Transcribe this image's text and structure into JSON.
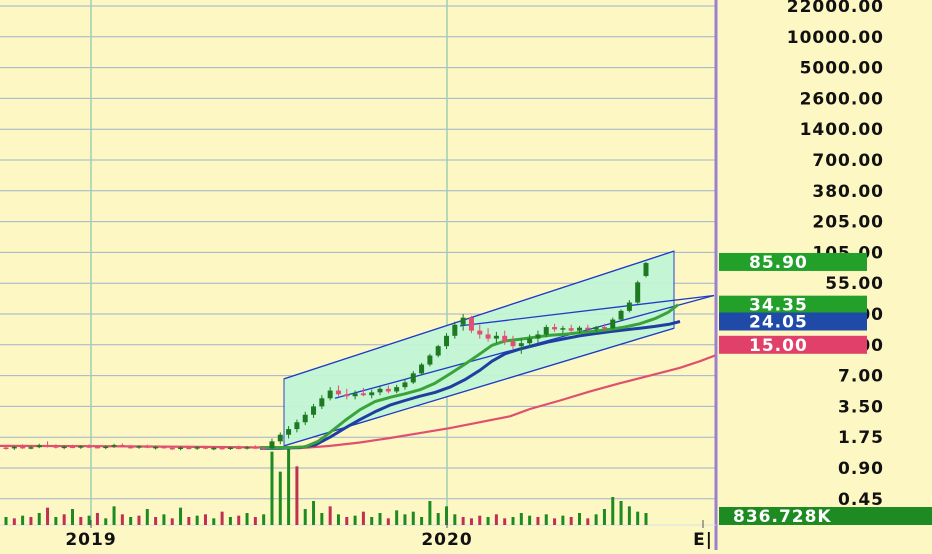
{
  "colors": {
    "background": "#fdf7c3",
    "grid": "#9fb3cc",
    "year_grid": "#9ecfb4",
    "divider": "#9b7fd0",
    "candle_up": "#1e7a22",
    "candle_down": "#e05070",
    "channel_line": "#1f3cc8",
    "channel_fill": "#c2f5d6",
    "ma_green": "#3aa33a",
    "ma_blue": "#1f3fa0",
    "ma_red": "#e0506e",
    "volume_up": "#1e8a22",
    "volume_down": "#c03050"
  },
  "chart_data": {
    "type": "candlestick",
    "scale": "log",
    "y_ticks": [
      "22000.00",
      "10000.00",
      "5000.00",
      "2600.00",
      "1400.00",
      "700.00",
      "380.00",
      "205.00",
      "105.00",
      "55.00",
      "28.00",
      "15.00",
      "7.00",
      "3.50",
      "1.75",
      "0.90",
      "0.45"
    ],
    "x_ticks": [
      "2019",
      "2020",
      "E|"
    ],
    "price_labels": [
      {
        "text": "85.90",
        "color": "#22a02a",
        "value": 85.9
      },
      {
        "text": "34.35",
        "color": "#22a02a",
        "value": 34.35
      },
      {
        "text": "24.05",
        "color": "#1f4aa8",
        "value": 24.05
      },
      {
        "text": "15.00",
        "color": "#e0406a",
        "value": 15.0
      }
    ],
    "volume_label": {
      "text": "836.728K",
      "color": "#1e8a22"
    },
    "ohlc": [
      {
        "o": 1.4,
        "h": 1.48,
        "l": 1.34,
        "c": 1.38
      },
      {
        "o": 1.38,
        "h": 1.45,
        "l": 1.33,
        "c": 1.42
      },
      {
        "o": 1.42,
        "h": 1.5,
        "l": 1.36,
        "c": 1.39
      },
      {
        "o": 1.39,
        "h": 1.46,
        "l": 1.35,
        "c": 1.41
      },
      {
        "o": 1.41,
        "h": 1.52,
        "l": 1.38,
        "c": 1.47
      },
      {
        "o": 1.47,
        "h": 1.6,
        "l": 1.4,
        "c": 1.44
      },
      {
        "o": 1.44,
        "h": 1.5,
        "l": 1.37,
        "c": 1.4
      },
      {
        "o": 1.4,
        "h": 1.46,
        "l": 1.35,
        "c": 1.43
      },
      {
        "o": 1.43,
        "h": 1.49,
        "l": 1.38,
        "c": 1.41
      },
      {
        "o": 1.41,
        "h": 1.47,
        "l": 1.36,
        "c": 1.44
      },
      {
        "o": 1.44,
        "h": 1.5,
        "l": 1.39,
        "c": 1.42
      },
      {
        "o": 1.42,
        "h": 1.47,
        "l": 1.37,
        "c": 1.4
      },
      {
        "o": 1.4,
        "h": 1.46,
        "l": 1.35,
        "c": 1.43
      },
      {
        "o": 1.43,
        "h": 1.52,
        "l": 1.39,
        "c": 1.48
      },
      {
        "o": 1.48,
        "h": 1.53,
        "l": 1.4,
        "c": 1.42
      },
      {
        "o": 1.42,
        "h": 1.48,
        "l": 1.37,
        "c": 1.41
      },
      {
        "o": 1.41,
        "h": 1.47,
        "l": 1.36,
        "c": 1.44
      },
      {
        "o": 1.44,
        "h": 1.49,
        "l": 1.38,
        "c": 1.4
      },
      {
        "o": 1.4,
        "h": 1.45,
        "l": 1.34,
        "c": 1.42
      },
      {
        "o": 1.42,
        "h": 1.46,
        "l": 1.37,
        "c": 1.39
      },
      {
        "o": 1.39,
        "h": 1.44,
        "l": 1.33,
        "c": 1.37
      },
      {
        "o": 1.37,
        "h": 1.43,
        "l": 1.32,
        "c": 1.4
      },
      {
        "o": 1.4,
        "h": 1.45,
        "l": 1.34,
        "c": 1.38
      },
      {
        "o": 1.38,
        "h": 1.44,
        "l": 1.33,
        "c": 1.41
      },
      {
        "o": 1.41,
        "h": 1.45,
        "l": 1.35,
        "c": 1.37
      },
      {
        "o": 1.37,
        "h": 1.42,
        "l": 1.32,
        "c": 1.39
      },
      {
        "o": 1.39,
        "h": 1.44,
        "l": 1.34,
        "c": 1.38
      },
      {
        "o": 1.38,
        "h": 1.43,
        "l": 1.33,
        "c": 1.4
      },
      {
        "o": 1.4,
        "h": 1.46,
        "l": 1.35,
        "c": 1.39
      },
      {
        "o": 1.39,
        "h": 1.45,
        "l": 1.34,
        "c": 1.41
      },
      {
        "o": 1.41,
        "h": 1.47,
        "l": 1.36,
        "c": 1.4
      },
      {
        "o": 1.4,
        "h": 1.45,
        "l": 1.34,
        "c": 1.38
      },
      {
        "o": 1.38,
        "h": 1.7,
        "l": 1.34,
        "c": 1.6
      },
      {
        "o": 1.6,
        "h": 1.95,
        "l": 1.5,
        "c": 1.85
      },
      {
        "o": 1.85,
        "h": 2.25,
        "l": 1.7,
        "c": 2.1
      },
      {
        "o": 2.1,
        "h": 2.6,
        "l": 1.95,
        "c": 2.45
      },
      {
        "o": 2.45,
        "h": 3.1,
        "l": 2.3,
        "c": 2.9
      },
      {
        "o": 2.9,
        "h": 3.7,
        "l": 2.7,
        "c": 3.5
      },
      {
        "o": 3.5,
        "h": 4.5,
        "l": 3.3,
        "c": 4.2
      },
      {
        "o": 4.2,
        "h": 5.4,
        "l": 4.0,
        "c": 5.0
      },
      {
        "o": 5.0,
        "h": 5.6,
        "l": 4.4,
        "c": 4.6
      },
      {
        "o": 4.6,
        "h": 5.2,
        "l": 4.1,
        "c": 4.4
      },
      {
        "o": 4.4,
        "h": 5.0,
        "l": 4.1,
        "c": 4.7
      },
      {
        "o": 4.7,
        "h": 5.3,
        "l": 4.4,
        "c": 4.5
      },
      {
        "o": 4.5,
        "h": 5.1,
        "l": 4.2,
        "c": 4.8
      },
      {
        "o": 4.8,
        "h": 5.5,
        "l": 4.5,
        "c": 5.2
      },
      {
        "o": 5.2,
        "h": 5.6,
        "l": 4.7,
        "c": 4.9
      },
      {
        "o": 4.9,
        "h": 5.7,
        "l": 4.7,
        "c": 5.4
      },
      {
        "o": 5.4,
        "h": 6.4,
        "l": 5.1,
        "c": 6.0
      },
      {
        "o": 6.0,
        "h": 7.8,
        "l": 5.8,
        "c": 7.4
      },
      {
        "o": 7.4,
        "h": 9.6,
        "l": 7.0,
        "c": 9.2
      },
      {
        "o": 9.2,
        "h": 12.0,
        "l": 8.8,
        "c": 11.5
      },
      {
        "o": 11.5,
        "h": 15.0,
        "l": 11.0,
        "c": 14.5
      },
      {
        "o": 14.5,
        "h": 19.0,
        "l": 13.5,
        "c": 18.0
      },
      {
        "o": 18.0,
        "h": 24.0,
        "l": 17.0,
        "c": 22.5
      },
      {
        "o": 22.5,
        "h": 28.0,
        "l": 20.0,
        "c": 26.0
      },
      {
        "o": 26.0,
        "h": 27.0,
        "l": 19.0,
        "c": 20.0
      },
      {
        "o": 20.0,
        "h": 22.5,
        "l": 17.0,
        "c": 18.5
      },
      {
        "o": 18.5,
        "h": 21.0,
        "l": 16.0,
        "c": 17.0
      },
      {
        "o": 17.0,
        "h": 19.5,
        "l": 15.5,
        "c": 18.0
      },
      {
        "o": 18.0,
        "h": 20.0,
        "l": 15.0,
        "c": 16.0
      },
      {
        "o": 16.0,
        "h": 18.0,
        "l": 13.5,
        "c": 14.5
      },
      {
        "o": 14.5,
        "h": 17.0,
        "l": 12.0,
        "c": 15.5
      },
      {
        "o": 15.5,
        "h": 18.5,
        "l": 14.0,
        "c": 17.0
      },
      {
        "o": 17.0,
        "h": 20.0,
        "l": 15.5,
        "c": 18.5
      },
      {
        "o": 18.5,
        "h": 22.5,
        "l": 17.5,
        "c": 21.5
      },
      {
        "o": 21.5,
        "h": 23.0,
        "l": 19.5,
        "c": 20.5
      },
      {
        "o": 20.5,
        "h": 22.0,
        "l": 19.0,
        "c": 21.0
      },
      {
        "o": 21.0,
        "h": 22.5,
        "l": 19.5,
        "c": 20.0
      },
      {
        "o": 20.0,
        "h": 22.0,
        "l": 19.0,
        "c": 21.2
      },
      {
        "o": 21.2,
        "h": 22.5,
        "l": 19.8,
        "c": 20.5
      },
      {
        "o": 20.5,
        "h": 22.0,
        "l": 19.5,
        "c": 21.5
      },
      {
        "o": 21.5,
        "h": 23.0,
        "l": 20.0,
        "c": 21.0
      },
      {
        "o": 21.0,
        "h": 26.0,
        "l": 20.5,
        "c": 25.0
      },
      {
        "o": 25.0,
        "h": 31.0,
        "l": 24.0,
        "c": 30.0
      },
      {
        "o": 30.0,
        "h": 38.0,
        "l": 29.0,
        "c": 36.0
      },
      {
        "o": 36.0,
        "h": 58.0,
        "l": 35.0,
        "c": 56.0
      },
      {
        "o": 64.0,
        "h": 85.9,
        "l": 62.0,
        "c": 84.0
      }
    ],
    "volume": [
      {
        "v": 6,
        "up": true
      },
      {
        "v": 5,
        "up": false
      },
      {
        "v": 7,
        "up": true
      },
      {
        "v": 6,
        "up": false
      },
      {
        "v": 9,
        "up": true
      },
      {
        "v": 13,
        "up": false
      },
      {
        "v": 6,
        "up": true
      },
      {
        "v": 8,
        "up": false
      },
      {
        "v": 12,
        "up": true
      },
      {
        "v": 6,
        "up": false
      },
      {
        "v": 7,
        "up": true
      },
      {
        "v": 9,
        "up": false
      },
      {
        "v": 5,
        "up": true
      },
      {
        "v": 14,
        "up": true
      },
      {
        "v": 8,
        "up": false
      },
      {
        "v": 6,
        "up": true
      },
      {
        "v": 7,
        "up": false
      },
      {
        "v": 12,
        "up": true
      },
      {
        "v": 6,
        "up": false
      },
      {
        "v": 8,
        "up": true
      },
      {
        "v": 5,
        "up": false
      },
      {
        "v": 13,
        "up": true
      },
      {
        "v": 6,
        "up": false
      },
      {
        "v": 7,
        "up": true
      },
      {
        "v": 8,
        "up": false
      },
      {
        "v": 5,
        "up": true
      },
      {
        "v": 10,
        "up": false
      },
      {
        "v": 6,
        "up": true
      },
      {
        "v": 7,
        "up": false
      },
      {
        "v": 9,
        "up": true
      },
      {
        "v": 6,
        "up": false
      },
      {
        "v": 8,
        "up": true
      },
      {
        "v": 55,
        "up": true
      },
      {
        "v": 40,
        "up": true
      },
      {
        "v": 58,
        "up": true
      },
      {
        "v": 44,
        "up": false
      },
      {
        "v": 12,
        "up": true
      },
      {
        "v": 18,
        "up": true
      },
      {
        "v": 9,
        "up": true
      },
      {
        "v": 14,
        "up": false
      },
      {
        "v": 8,
        "up": true
      },
      {
        "v": 6,
        "up": false
      },
      {
        "v": 7,
        "up": true
      },
      {
        "v": 10,
        "up": false
      },
      {
        "v": 6,
        "up": true
      },
      {
        "v": 9,
        "up": true
      },
      {
        "v": 5,
        "up": false
      },
      {
        "v": 11,
        "up": true
      },
      {
        "v": 8,
        "up": true
      },
      {
        "v": 10,
        "up": true
      },
      {
        "v": 6,
        "up": true
      },
      {
        "v": 18,
        "up": true
      },
      {
        "v": 9,
        "up": true
      },
      {
        "v": 14,
        "up": true
      },
      {
        "v": 8,
        "up": true
      },
      {
        "v": 6,
        "up": false
      },
      {
        "v": 5,
        "up": false
      },
      {
        "v": 7,
        "up": false
      },
      {
        "v": 6,
        "up": true
      },
      {
        "v": 8,
        "up": false
      },
      {
        "v": 5,
        "up": false
      },
      {
        "v": 6,
        "up": true
      },
      {
        "v": 9,
        "up": true
      },
      {
        "v": 7,
        "up": true
      },
      {
        "v": 6,
        "up": false
      },
      {
        "v": 8,
        "up": true
      },
      {
        "v": 5,
        "up": false
      },
      {
        "v": 7,
        "up": true
      },
      {
        "v": 6,
        "up": false
      },
      {
        "v": 9,
        "up": true
      },
      {
        "v": 5,
        "up": false
      },
      {
        "v": 8,
        "up": true
      },
      {
        "v": 12,
        "up": true
      },
      {
        "v": 21,
        "up": true
      },
      {
        "v": 18,
        "up": true
      },
      {
        "v": 14,
        "up": true
      },
      {
        "v": 10,
        "up": true
      },
      {
        "v": 9,
        "up": true
      }
    ],
    "ma_green": [
      [
        260,
        1.4
      ],
      [
        275,
        1.4
      ],
      [
        290,
        1.4
      ],
      [
        305,
        1.42
      ],
      [
        318,
        1.6
      ],
      [
        330,
        1.95
      ],
      [
        345,
        2.55
      ],
      [
        360,
        3.25
      ],
      [
        375,
        3.9
      ],
      [
        390,
        4.3
      ],
      [
        405,
        4.65
      ],
      [
        420,
        5.1
      ],
      [
        435,
        5.9
      ],
      [
        450,
        7.3
      ],
      [
        465,
        9.3
      ],
      [
        480,
        12.0
      ],
      [
        492,
        14.8
      ],
      [
        505,
        16.2
      ],
      [
        520,
        16.8
      ],
      [
        535,
        17.5
      ],
      [
        550,
        18.2
      ],
      [
        565,
        18.6
      ],
      [
        580,
        19.2
      ],
      [
        595,
        19.7
      ],
      [
        610,
        20.5
      ],
      [
        625,
        21.5
      ],
      [
        640,
        23.0
      ],
      [
        655,
        25.5
      ],
      [
        668,
        29.0
      ],
      [
        678,
        34.35
      ]
    ],
    "ma_blue": [
      [
        260,
        1.38
      ],
      [
        280,
        1.38
      ],
      [
        300,
        1.4
      ],
      [
        315,
        1.48
      ],
      [
        330,
        1.75
      ],
      [
        345,
        2.15
      ],
      [
        360,
        2.6
      ],
      [
        375,
        3.1
      ],
      [
        390,
        3.6
      ],
      [
        405,
        4.0
      ],
      [
        420,
        4.4
      ],
      [
        435,
        4.8
      ],
      [
        450,
        5.4
      ],
      [
        465,
        6.4
      ],
      [
        480,
        8.0
      ],
      [
        492,
        10.0
      ],
      [
        505,
        12.0
      ],
      [
        520,
        13.5
      ],
      [
        535,
        14.8
      ],
      [
        550,
        16.0
      ],
      [
        565,
        17.0
      ],
      [
        580,
        18.0
      ],
      [
        595,
        18.8
      ],
      [
        610,
        19.6
      ],
      [
        625,
        20.3
      ],
      [
        640,
        21.0
      ],
      [
        655,
        21.8
      ],
      [
        670,
        22.8
      ],
      [
        680,
        24.05
      ]
    ],
    "ma_red": [
      [
        0,
        1.45
      ],
      [
        100,
        1.44
      ],
      [
        200,
        1.42
      ],
      [
        270,
        1.4
      ],
      [
        300,
        1.38
      ],
      [
        330,
        1.45
      ],
      [
        360,
        1.56
      ],
      [
        390,
        1.72
      ],
      [
        420,
        1.92
      ],
      [
        450,
        2.15
      ],
      [
        480,
        2.45
      ],
      [
        510,
        2.8
      ],
      [
        530,
        3.3
      ],
      [
        560,
        4.0
      ],
      [
        590,
        4.9
      ],
      [
        620,
        5.9
      ],
      [
        650,
        7.0
      ],
      [
        680,
        8.5
      ],
      [
        700,
        10.0
      ],
      [
        715,
        11.5
      ]
    ],
    "channel": {
      "upper": [
        [
          284,
          6.5
        ],
        [
          674,
          108.0
        ]
      ],
      "lower": [
        [
          284,
          1.45
        ],
        [
          674,
          21.0
        ]
      ],
      "line2": [
        [
          335,
          4.2
        ],
        [
          714,
          42.0
        ]
      ],
      "line3": [
        [
          460,
          22.0
        ],
        [
          714,
          42.0
        ]
      ]
    }
  }
}
